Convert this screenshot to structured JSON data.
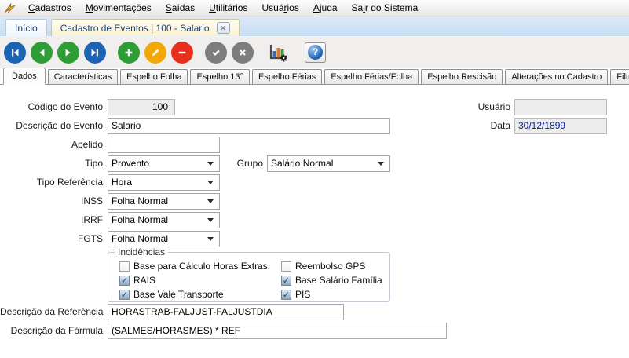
{
  "menubar": {
    "items": [
      {
        "label": "Cadastros",
        "accel": "C"
      },
      {
        "label": "Movimentações",
        "accel": "M"
      },
      {
        "label": "Saídas",
        "accel": "S"
      },
      {
        "label": "Utilitários",
        "accel": "U"
      },
      {
        "label": "Usuários",
        "accel": "r"
      },
      {
        "label": "Ajuda",
        "accel": "A"
      },
      {
        "label": "Sair do Sistema",
        "accel": "i"
      }
    ]
  },
  "document_tabs": [
    {
      "label": "Início",
      "active": false,
      "closable": false
    },
    {
      "label": "Cadastro de Eventos | 100 - Salario",
      "active": true,
      "closable": true
    }
  ],
  "toolbar": {
    "buttons": [
      {
        "name": "first-record-button",
        "icon": "first-icon",
        "bg": "#1d63b4",
        "group": 1
      },
      {
        "name": "previous-record-button",
        "icon": "previous-icon",
        "bg": "#2f9d36",
        "group": 1
      },
      {
        "name": "next-record-button",
        "icon": "next-icon",
        "bg": "#2f9d36",
        "group": 1
      },
      {
        "name": "last-record-button",
        "icon": "last-icon",
        "bg": "#1d63b4",
        "group": 1
      },
      {
        "name": "add-button",
        "icon": "plus-icon",
        "bg": "#2f9d36",
        "group": 2
      },
      {
        "name": "edit-button",
        "icon": "pencil-icon",
        "bg": "#f3a807",
        "group": 2
      },
      {
        "name": "delete-button",
        "icon": "minus-icon",
        "bg": "#e7301c",
        "group": 2
      },
      {
        "name": "confirm-button",
        "icon": "check-icon",
        "bg": "#7d7d7d",
        "group": 3
      },
      {
        "name": "cancel-button",
        "icon": "x-icon",
        "bg": "#7d7d7d",
        "group": 3
      },
      {
        "name": "report-chart-button",
        "icon": "bar-chart-gear-icon",
        "bg": "none",
        "group": 4
      },
      {
        "name": "help-button",
        "icon": "question-icon",
        "bg": "help",
        "group": 5
      }
    ]
  },
  "page_tabs": [
    "Dados",
    "Características",
    "Espelho Folha",
    "Espelho 13°",
    "Espelho Férias",
    "Espelho Férias/Folha",
    "Espelho Rescisão",
    "Alterações no Cadastro",
    "Filtros"
  ],
  "active_page_tab": "Dados",
  "form": {
    "codigo": {
      "label": "Código do Evento",
      "value": "100"
    },
    "usuario": {
      "label": "Usuário",
      "value": ""
    },
    "descricao_evento": {
      "label": "Descrição do Evento",
      "value": "Salario"
    },
    "data": {
      "label": "Data",
      "value": "30/12/1899"
    },
    "apelido": {
      "label": "Apelido",
      "value": ""
    },
    "tipo": {
      "label": "Tipo",
      "value": "Provento"
    },
    "grupo": {
      "label": "Grupo",
      "value": "Salário Normal"
    },
    "tipo_referencia": {
      "label": "Tipo Referência",
      "value": "Hora"
    },
    "inss": {
      "label": "INSS",
      "value": "Folha Normal"
    },
    "irrf": {
      "label": "IRRF",
      "value": "Folha Normal"
    },
    "fgts": {
      "label": "FGTS",
      "value": "Folha Normal"
    },
    "incidencias": {
      "title": "Incidências",
      "col1": [
        {
          "label": "Base para Cálculo Horas Extras.",
          "checked": false
        },
        {
          "label": "RAIS",
          "checked": true
        },
        {
          "label": "Base Vale Transporte",
          "checked": true
        }
      ],
      "col2": [
        {
          "label": "Reembolso GPS",
          "checked": false
        },
        {
          "label": "Base Salário Família",
          "checked": true
        },
        {
          "label": "PIS",
          "checked": true
        }
      ]
    },
    "descricao_referencia": {
      "label": "Descrição da Referência",
      "value": "HORASTRAB-FALJUST-FALJUSTDIA"
    },
    "descricao_formula": {
      "label": "Descrição da Fórmula",
      "value": "(SALMES/HORASMES) * REF"
    }
  }
}
